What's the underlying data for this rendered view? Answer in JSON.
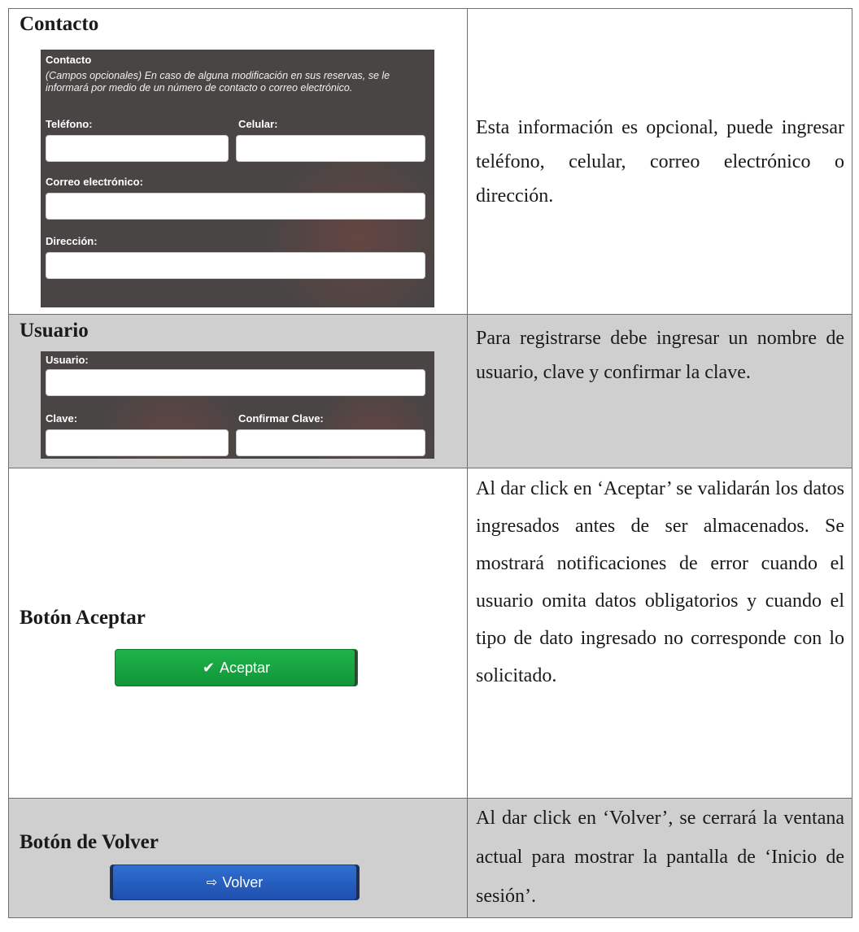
{
  "rows": [
    {
      "title": "Contacto",
      "description": "Esta información es opcional, puede ingresar teléfono, celular, correo electrónico o dirección.",
      "panel": {
        "heading": "Contacto",
        "note": "(Campos opcionales) En caso de alguna modificación en sus reservas, se le informará por medio de un número de contacto o correo electrónico.",
        "phone_label": "Teléfono:",
        "cell_label": "Celular:",
        "email_label": "Correo electrónico:",
        "address_label": "Dirección:",
        "phone_value": "",
        "cell_value": "",
        "email_value": "",
        "address_value": ""
      }
    },
    {
      "title": "Usuario",
      "description": "Para registrarse debe ingresar un nombre de usuario, clave y confirmar la clave.",
      "panel": {
        "user_label": "Usuario:",
        "password_label": "Clave:",
        "confirm_label": "Confirmar Clave:",
        "user_value": "",
        "password_value": "",
        "confirm_value": ""
      }
    },
    {
      "title": "Botón Aceptar",
      "description": "Al dar click en ‘Aceptar’ se validarán los datos ingresados antes de ser almacenados. Se mostrará notificaciones de error cuando el usuario omita datos obligatorios y cuando el tipo de dato ingresado no corresponde con lo solicitado.",
      "button_label": "Aceptar",
      "button_icon": "check-icon"
    },
    {
      "title": "Botón de Volver",
      "description": "Al dar click en ‘Volver’, se cerrará la ventana actual para mostrar la pantalla de ‘Inicio de sesión’.",
      "button_label": "Volver",
      "button_icon": "sign-out-icon"
    }
  ],
  "colors": {
    "panel_bg": "#4a4545",
    "accept_green": "#16a341",
    "back_blue": "#2a62c4",
    "shaded_row": "#cfcfcf"
  }
}
